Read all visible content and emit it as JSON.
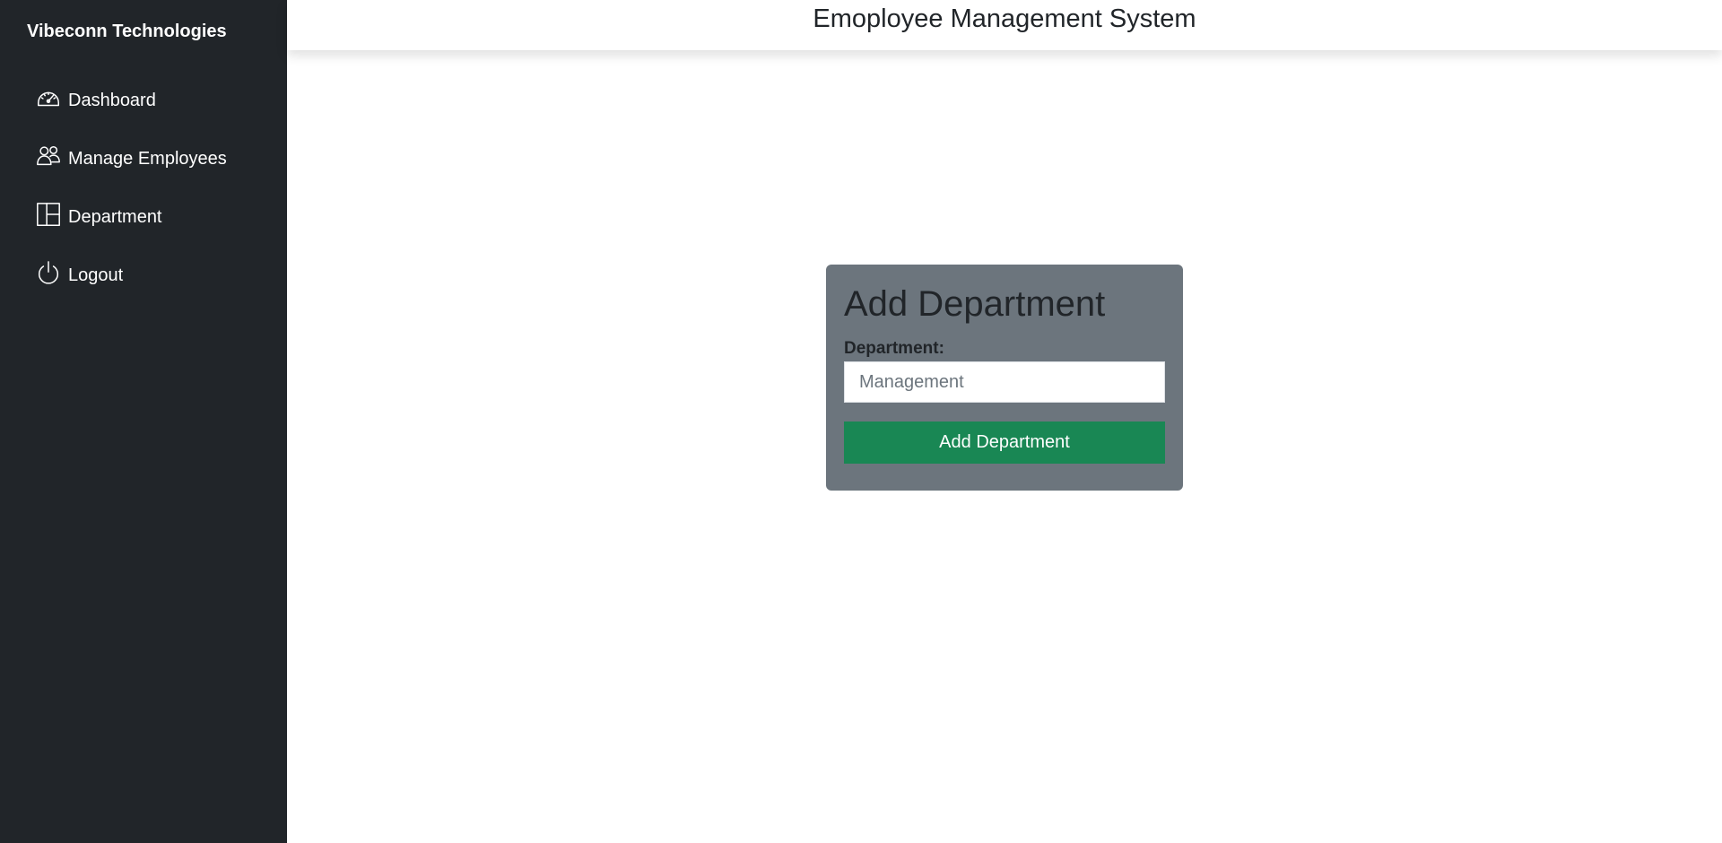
{
  "brand": {
    "name": "Vibeconn Technologies"
  },
  "sidebar": {
    "items": [
      {
        "label": "Dashboard",
        "icon": "speedometer-icon"
      },
      {
        "label": "Manage Employees",
        "icon": "people-icon"
      },
      {
        "label": "Department",
        "icon": "columns-layout-icon"
      },
      {
        "label": "Logout",
        "icon": "power-icon"
      }
    ]
  },
  "header": {
    "title": "Emoployee Management System"
  },
  "form": {
    "title": "Add Department",
    "department_label": "Department:",
    "department_placeholder": "Management",
    "submit_label": "Add Department"
  },
  "colors": {
    "sidebar_bg": "#212529",
    "card_bg": "#6c757d",
    "button_bg": "#198754",
    "text_dark": "#212529"
  }
}
